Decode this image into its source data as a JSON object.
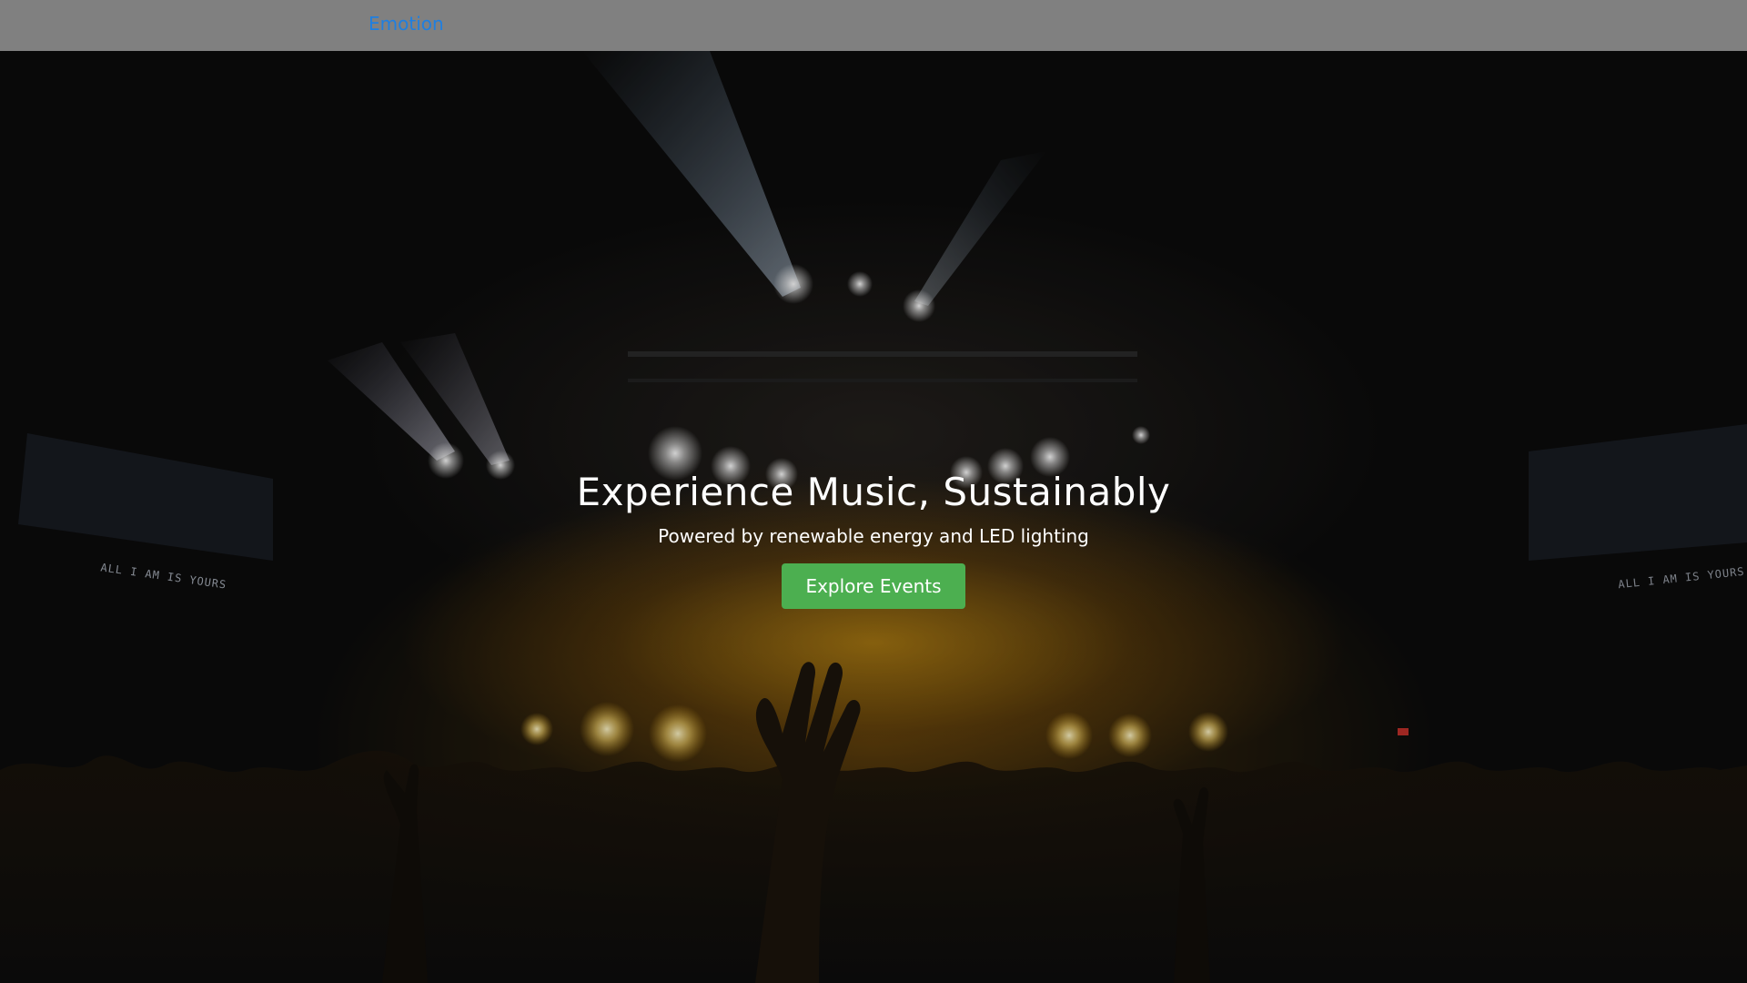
{
  "navbar": {
    "brand": "Emotion"
  },
  "hero": {
    "title": "Experience Music, Sustainably",
    "subtitle": "Powered by renewable energy and LED lighting",
    "cta_label": "Explore Events",
    "screen_text_left": "ALL I AM IS YOURS",
    "screen_text_right": "ALL I AM IS YOURS"
  },
  "colors": {
    "navbar_bg": "#808080",
    "brand": "#1f7fe0",
    "cta_bg": "#4caf50",
    "stage_glow": "#d4a017"
  }
}
